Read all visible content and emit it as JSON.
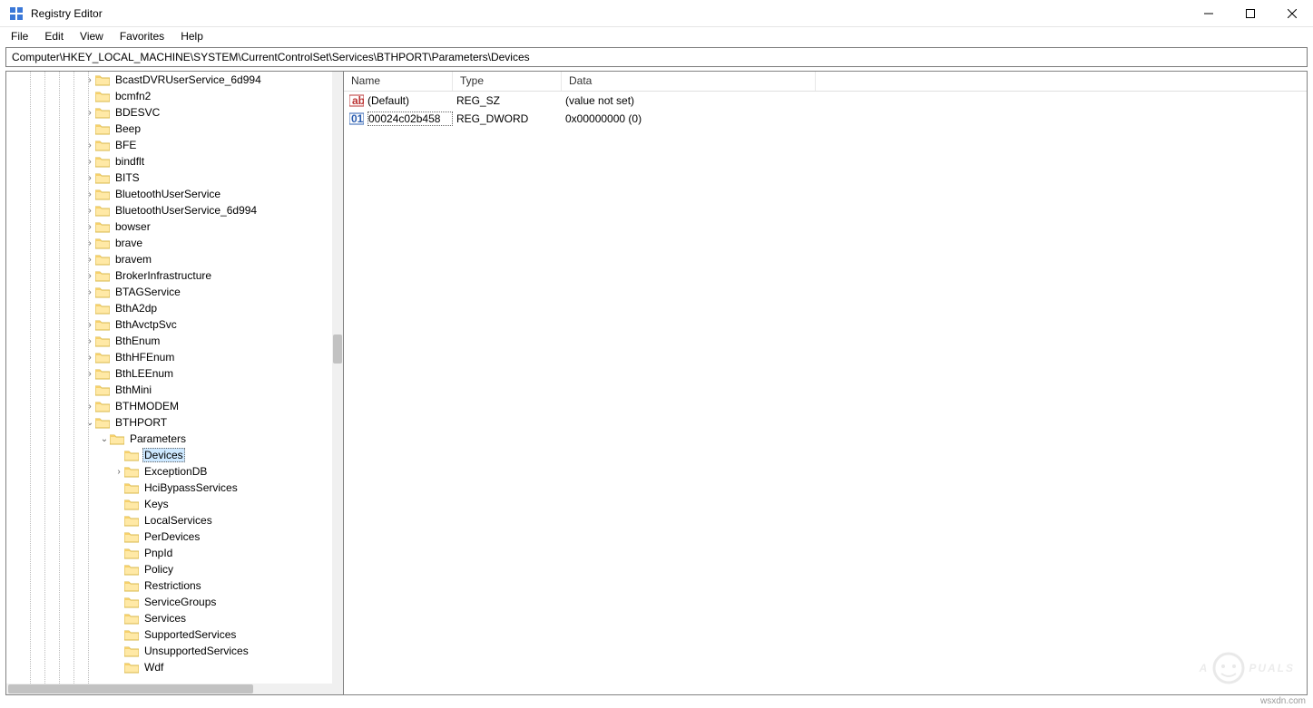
{
  "window": {
    "title": "Registry Editor"
  },
  "menu": {
    "file": "File",
    "edit": "Edit",
    "view": "View",
    "favorites": "Favorites",
    "help": "Help"
  },
  "address": "Computer\\HKEY_LOCAL_MACHINE\\SYSTEM\\CurrentControlSet\\Services\\BTHPORT\\Parameters\\Devices",
  "tree": {
    "indent_lines": [
      26,
      42,
      58,
      74,
      90
    ],
    "items": [
      {
        "depth": 5,
        "expander": ">",
        "label": "BcastDVRUserService_6d994"
      },
      {
        "depth": 5,
        "expander": "",
        "label": "bcmfn2"
      },
      {
        "depth": 5,
        "expander": ">",
        "label": "BDESVC"
      },
      {
        "depth": 5,
        "expander": "",
        "label": "Beep"
      },
      {
        "depth": 5,
        "expander": ">",
        "label": "BFE"
      },
      {
        "depth": 5,
        "expander": ">",
        "label": "bindflt"
      },
      {
        "depth": 5,
        "expander": ">",
        "label": "BITS"
      },
      {
        "depth": 5,
        "expander": ">",
        "label": "BluetoothUserService"
      },
      {
        "depth": 5,
        "expander": ">",
        "label": "BluetoothUserService_6d994"
      },
      {
        "depth": 5,
        "expander": ">",
        "label": "bowser"
      },
      {
        "depth": 5,
        "expander": ">",
        "label": "brave"
      },
      {
        "depth": 5,
        "expander": ">",
        "label": "bravem"
      },
      {
        "depth": 5,
        "expander": ">",
        "label": "BrokerInfrastructure"
      },
      {
        "depth": 5,
        "expander": ">",
        "label": "BTAGService"
      },
      {
        "depth": 5,
        "expander": "",
        "label": "BthA2dp"
      },
      {
        "depth": 5,
        "expander": ">",
        "label": "BthAvctpSvc"
      },
      {
        "depth": 5,
        "expander": ">",
        "label": "BthEnum"
      },
      {
        "depth": 5,
        "expander": ">",
        "label": "BthHFEnum"
      },
      {
        "depth": 5,
        "expander": ">",
        "label": "BthLEEnum"
      },
      {
        "depth": 5,
        "expander": "",
        "label": "BthMini"
      },
      {
        "depth": 5,
        "expander": ">",
        "label": "BTHMODEM"
      },
      {
        "depth": 5,
        "expander": "v",
        "label": "BTHPORT"
      },
      {
        "depth": 6,
        "expander": "v",
        "label": "Parameters"
      },
      {
        "depth": 7,
        "expander": "",
        "label": "Devices",
        "selected": true
      },
      {
        "depth": 7,
        "expander": ">",
        "label": "ExceptionDB"
      },
      {
        "depth": 7,
        "expander": "",
        "label": "HciBypassServices"
      },
      {
        "depth": 7,
        "expander": "",
        "label": "Keys"
      },
      {
        "depth": 7,
        "expander": "",
        "label": "LocalServices"
      },
      {
        "depth": 7,
        "expander": "",
        "label": "PerDevices"
      },
      {
        "depth": 7,
        "expander": "",
        "label": "PnpId"
      },
      {
        "depth": 7,
        "expander": "",
        "label": "Policy"
      },
      {
        "depth": 7,
        "expander": "",
        "label": "Restrictions"
      },
      {
        "depth": 7,
        "expander": "",
        "label": "ServiceGroups"
      },
      {
        "depth": 7,
        "expander": "",
        "label": "Services"
      },
      {
        "depth": 7,
        "expander": "",
        "label": "SupportedServices"
      },
      {
        "depth": 7,
        "expander": "",
        "label": "UnsupportedServices"
      },
      {
        "depth": 7,
        "expander": "",
        "label": "Wdf"
      }
    ]
  },
  "values": {
    "headers": {
      "name": "Name",
      "type": "Type",
      "data": "Data"
    },
    "rows": [
      {
        "icon": "string",
        "name": "(Default)",
        "type": "REG_SZ",
        "data": "(value not set)"
      },
      {
        "icon": "binary",
        "name": "00024c02b458",
        "type": "REG_DWORD",
        "data": "0x00000000 (0)",
        "selected": true
      }
    ]
  },
  "watermark": {
    "pre": "A",
    "post": "PUALS"
  },
  "footer_url": "wsxdn.com"
}
